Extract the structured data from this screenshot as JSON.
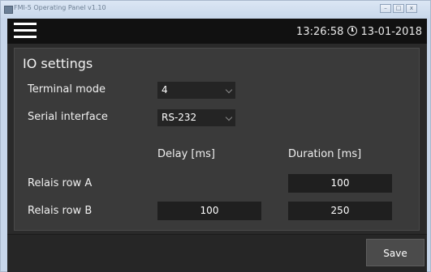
{
  "window": {
    "title": "FMI-5 Operating Panel v1.10",
    "minimize_glyph": "–",
    "maximize_glyph": "□",
    "close_glyph": "x"
  },
  "header": {
    "menu_icon": "hamburger-menu-icon",
    "time": "13:26:58",
    "clock_icon": "clock-icon",
    "date": "13-01-2018"
  },
  "io_settings": {
    "title": "IO settings",
    "terminal_mode": {
      "label": "Terminal mode",
      "value": "4"
    },
    "serial_interface": {
      "label": "Serial interface",
      "value": "RS-232"
    },
    "columns": {
      "delay": "Delay [ms]",
      "duration": "Duration [ms]"
    },
    "rows": [
      {
        "label": "Relais row A",
        "delay": "",
        "duration": "100"
      },
      {
        "label": "Relais row B",
        "delay": "100",
        "duration": "250"
      }
    ]
  },
  "footer": {
    "save_label": "Save"
  },
  "colors": {
    "background": "#2a2a2a",
    "card": "#3a3a3a",
    "input": "#1f1f1f",
    "header": "#111111",
    "text": "#f0f0f0"
  }
}
